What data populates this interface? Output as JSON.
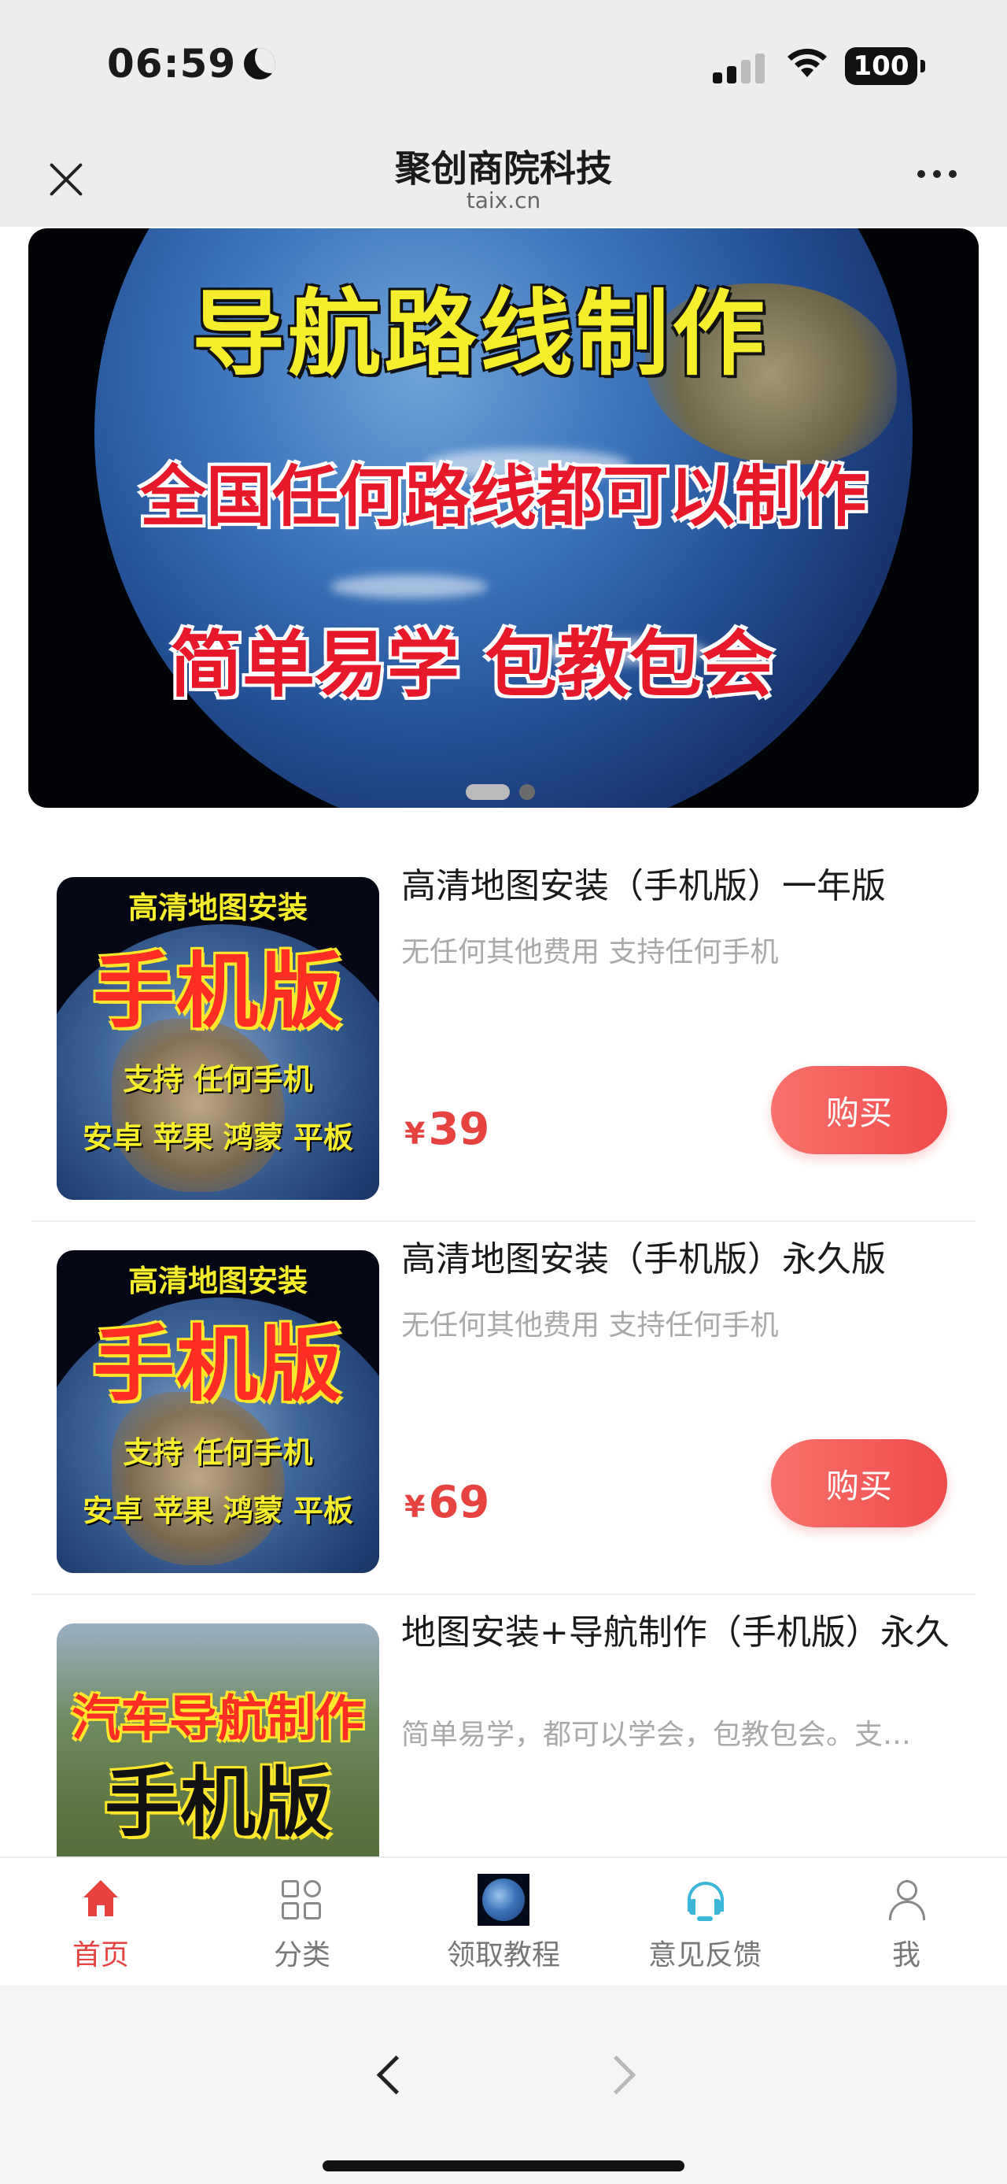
{
  "status_bar": {
    "time": "06:59",
    "battery": "100"
  },
  "header": {
    "title": "聚创商院科技",
    "subtitle": "taix.cn"
  },
  "banner": {
    "line1": "导航路线制作",
    "line2": "全国任何路线都可以制作",
    "line3": "简单易学 包教包会"
  },
  "products": [
    {
      "title": "高清地图安装（手机版）一年版",
      "desc": "无任何其他费用 支持任何手机",
      "currency": "¥",
      "price": "39",
      "buy_label": "购买",
      "thumb": {
        "line1": "高清地图安装",
        "line2": "手机版",
        "line3": "支持 任何手机",
        "line4": "安卓 苹果 鸿蒙 平板"
      }
    },
    {
      "title": "高清地图安装（手机版）永久版",
      "desc": "无任何其他费用 支持任何手机",
      "currency": "¥",
      "price": "69",
      "buy_label": "购买",
      "thumb": {
        "line1": "高清地图安装",
        "line2": "手机版",
        "line3": "支持 任何手机",
        "line4": "安卓 苹果 鸿蒙 平板"
      }
    },
    {
      "title": "地图安装+导航制作（手机版）永久",
      "desc": "简单易学，都可以学会，包教包会。支…",
      "thumb": {
        "line1": "汽车导航制作",
        "line2": "手机版"
      }
    }
  ],
  "tabbar": {
    "items": [
      {
        "label": "首页",
        "icon": "home-icon",
        "active": true
      },
      {
        "label": "分类",
        "icon": "category-grid-icon"
      },
      {
        "label": "领取教程",
        "icon": "earth-icon"
      },
      {
        "label": "意见反馈",
        "icon": "headset-icon"
      },
      {
        "label": "我",
        "icon": "user-icon"
      }
    ]
  },
  "colors": {
    "accent": "#e64340",
    "buy_button": "#f15a57",
    "feedback_icon": "#3bb6d8"
  }
}
